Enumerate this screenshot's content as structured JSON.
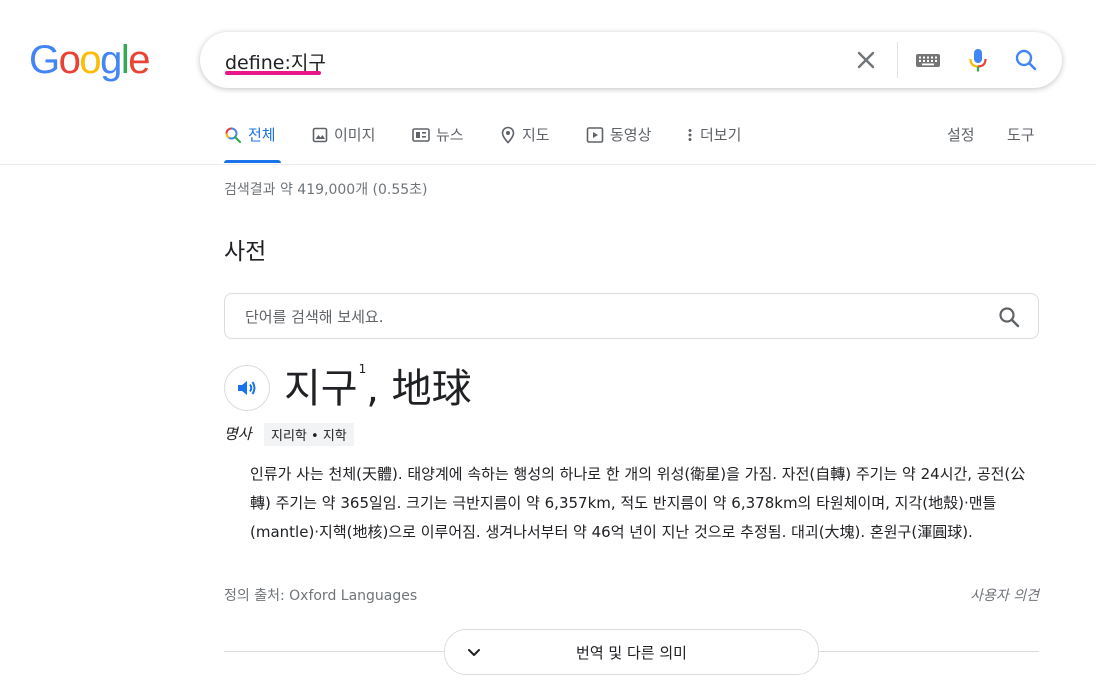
{
  "logo": {
    "letters": [
      "G",
      "o",
      "o",
      "g",
      "l",
      "e"
    ],
    "colors": [
      "#4285f4",
      "#ea4335",
      "#fbbc05",
      "#4285f4",
      "#34a853",
      "#ea4335"
    ]
  },
  "search": {
    "query": "define:지구"
  },
  "tabs": [
    {
      "label": "전체",
      "icon": "search-icon",
      "active": true
    },
    {
      "label": "이미지",
      "icon": "image-icon"
    },
    {
      "label": "뉴스",
      "icon": "news-icon"
    },
    {
      "label": "지도",
      "icon": "map-pin-icon"
    },
    {
      "label": "동영상",
      "icon": "video-icon"
    },
    {
      "label": "더보기",
      "icon": "more-vertical-icon"
    }
  ],
  "tools": {
    "settings": "설정",
    "tools": "도구"
  },
  "stats": "검색결과 약 419,000개 (0.55초)",
  "dictionary": {
    "title": "사전",
    "search_placeholder": "단어를 검색해 보세요.",
    "word": "지구",
    "superscript": "1",
    "hanja": ", 地球",
    "pos": "명사",
    "field": "지리학 • 지학",
    "definition": "인류가 사는 천체(天體). 태양계에 속하는 행성의 하나로 한 개의 위성(衛星)을 가짐. 자전(自轉) 주기는 약 24시간, 공전(公轉) 주기는 약 365일임. 크기는 극반지름이 약 6,357km, 적도 반지름이 약 6,378km의 타원체이며, 지각(地殼)·맨틀(mantle)·지핵(地核)으로 이루어짐. 생겨나서부터 약 46억 년이 지난 것으로 추정됨. 대괴(大塊). 혼원구(渾圓球).",
    "source": "정의 출처: Oxford Languages",
    "feedback": "사용자 의견",
    "more_button": "번역 및 다른 의미"
  }
}
